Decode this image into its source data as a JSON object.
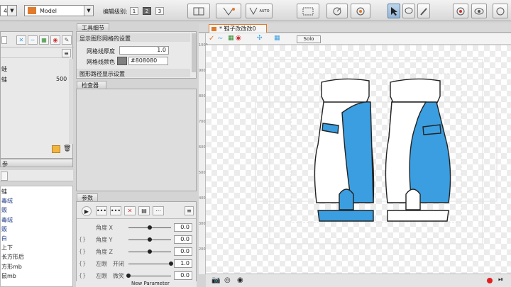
{
  "toolbar": {
    "version": "4.0",
    "mode": "Model",
    "edit_level_label": "编辑级别:",
    "levels": [
      "1",
      "2",
      "3"
    ],
    "auto_label": "AUTO"
  },
  "left_panel": {
    "values": [
      {
        "label": "蛙",
        "value": ""
      },
      {
        "label": "蛙",
        "value": "500"
      }
    ],
    "section_header": "参",
    "items": [
      {
        "label": "蛙",
        "blue": false
      },
      {
        "label": "毒绒",
        "blue": true
      },
      {
        "label": "贩",
        "blue": true
      },
      {
        "label": "毒绒",
        "blue": true
      },
      {
        "label": "贩",
        "blue": true
      },
      {
        "label": "白",
        "blue": true
      },
      {
        "label": "上下",
        "blue": false
      },
      {
        "label": "长方形后",
        "blue": false
      },
      {
        "label": "方形mb",
        "blue": false
      },
      {
        "label": "鼠mb",
        "blue": false
      }
    ]
  },
  "tool_details": {
    "tab": "工具细节",
    "section1": "显示图形网格的设置",
    "grid_thickness_label": "网格线厚度",
    "grid_thickness_value": "1.0",
    "grid_color_label": "网格线颜色",
    "grid_color_value": "#808080",
    "section2": "图形路径显示设置"
  },
  "inspector": {
    "title": "检查器"
  },
  "params": {
    "title": "参数",
    "rows": [
      {
        "brace": "",
        "name": "角度 X",
        "value": "0.0",
        "level": 0.5
      },
      {
        "brace": "{}",
        "name": "角度 Y",
        "value": "0.0",
        "level": 0.5
      },
      {
        "brace": "{}",
        "name": "角度 Z",
        "value": "0.0",
        "level": 0.5
      },
      {
        "brace": "{}",
        "name": "左眼　开闭",
        "value": "1.0",
        "level": 1.0
      },
      {
        "brace": "{}",
        "name": "左眼　微笑",
        "value": "0.0",
        "level": 0.0
      }
    ],
    "new_param_label": "New Parameter"
  },
  "document": {
    "tab_title": "* 鞋子改改改0",
    "solo_label": "Solo",
    "ruler_numbers": [
      "1000",
      "900",
      "800",
      "700",
      "600",
      "500",
      "400",
      "300",
      "200"
    ]
  },
  "colors": {
    "accent_orange": "#e07a2c",
    "shoe_blue": "#3a9ee0",
    "grid_color": "#808080"
  }
}
